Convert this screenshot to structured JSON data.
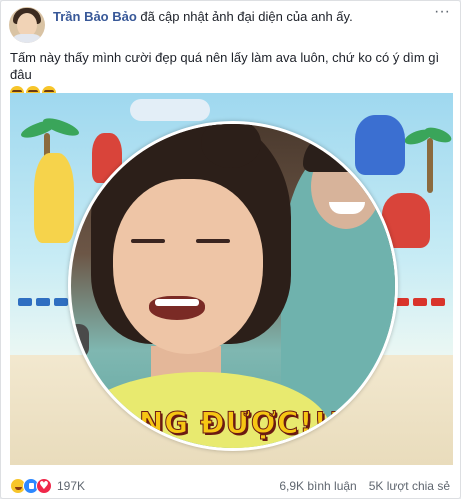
{
  "post": {
    "author": "Trần Bảo Bảo",
    "action": "đã cập nhật ảnh đại diện của anh ấy.",
    "more_label": "···",
    "caption": "Tấm này thấy mình cười đẹp quá nên lấy làm ava luôn, chứ ko có ý dìm gì đâu",
    "caption_emoji": [
      "rolling-on-floor-laughing",
      "rolling-on-floor-laughing",
      "rolling-on-floor-laughing"
    ],
    "image": {
      "shirt_text": "NG ĐƯỢC!!!"
    },
    "reactions": {
      "types": [
        "haha",
        "like",
        "love"
      ],
      "count": "197K"
    },
    "stats": {
      "comments": "6,9K bình luận",
      "shares": "5K lượt chia sẻ"
    }
  },
  "colors": {
    "author_link": "#385898",
    "text": "#1d2129",
    "muted": "#606770",
    "shirt_text": "#f6c613"
  }
}
